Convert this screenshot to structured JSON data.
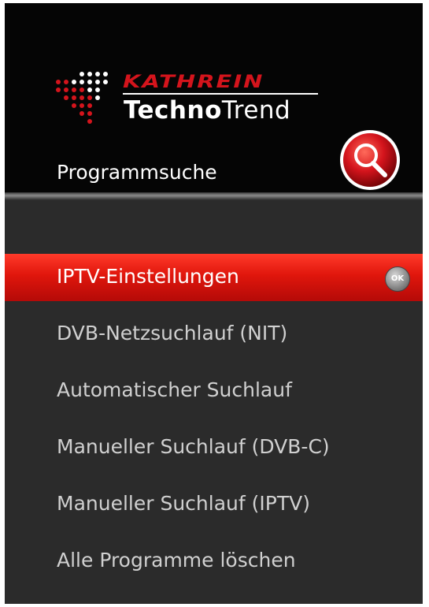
{
  "brand": {
    "name": "KATHREIN",
    "sub_bold": "Techno",
    "sub_light": "Trend"
  },
  "header": {
    "title": "Programmsuche",
    "search_icon": "search-icon"
  },
  "menu": {
    "items": [
      {
        "label": "IPTV-Einstellungen",
        "selected": true,
        "badge": "OK"
      },
      {
        "label": "DVB-Netzsuchlauf (NIT)",
        "selected": false
      },
      {
        "label": "Automatischer Suchlauf",
        "selected": false
      },
      {
        "label": "Manueller Suchlauf (DVB-C)",
        "selected": false
      },
      {
        "label": "Manueller Suchlauf (IPTV)",
        "selected": false
      },
      {
        "label": "Alle Programme löschen",
        "selected": false
      }
    ]
  },
  "colors": {
    "accent": "#e0160c",
    "brand_red": "#d4141c",
    "background": "#2b2b2b",
    "header": "#050505",
    "text": "#d0d0d0"
  }
}
